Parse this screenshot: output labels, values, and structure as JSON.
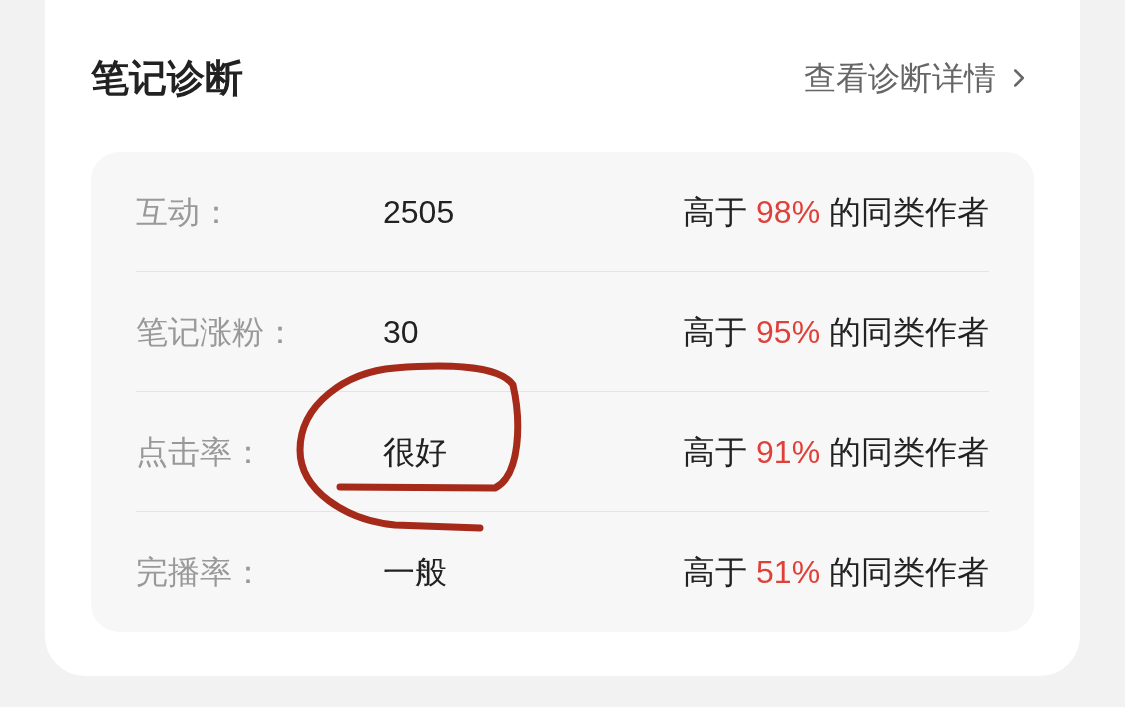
{
  "header": {
    "title": "笔记诊断",
    "link": "查看诊断详情"
  },
  "rows": [
    {
      "label": "互动：",
      "value": "2505",
      "prefix": "高于",
      "percent": "98%",
      "suffix": "的同类作者"
    },
    {
      "label": "笔记涨粉：",
      "value": "30",
      "prefix": "高于",
      "percent": "95%",
      "suffix": "的同类作者"
    },
    {
      "label": "点击率：",
      "value": "很好",
      "prefix": "高于",
      "percent": "91%",
      "suffix": "的同类作者"
    },
    {
      "label": "完播率：",
      "value": "一般",
      "prefix": "高于",
      "percent": "51%",
      "suffix": "的同类作者"
    }
  ]
}
